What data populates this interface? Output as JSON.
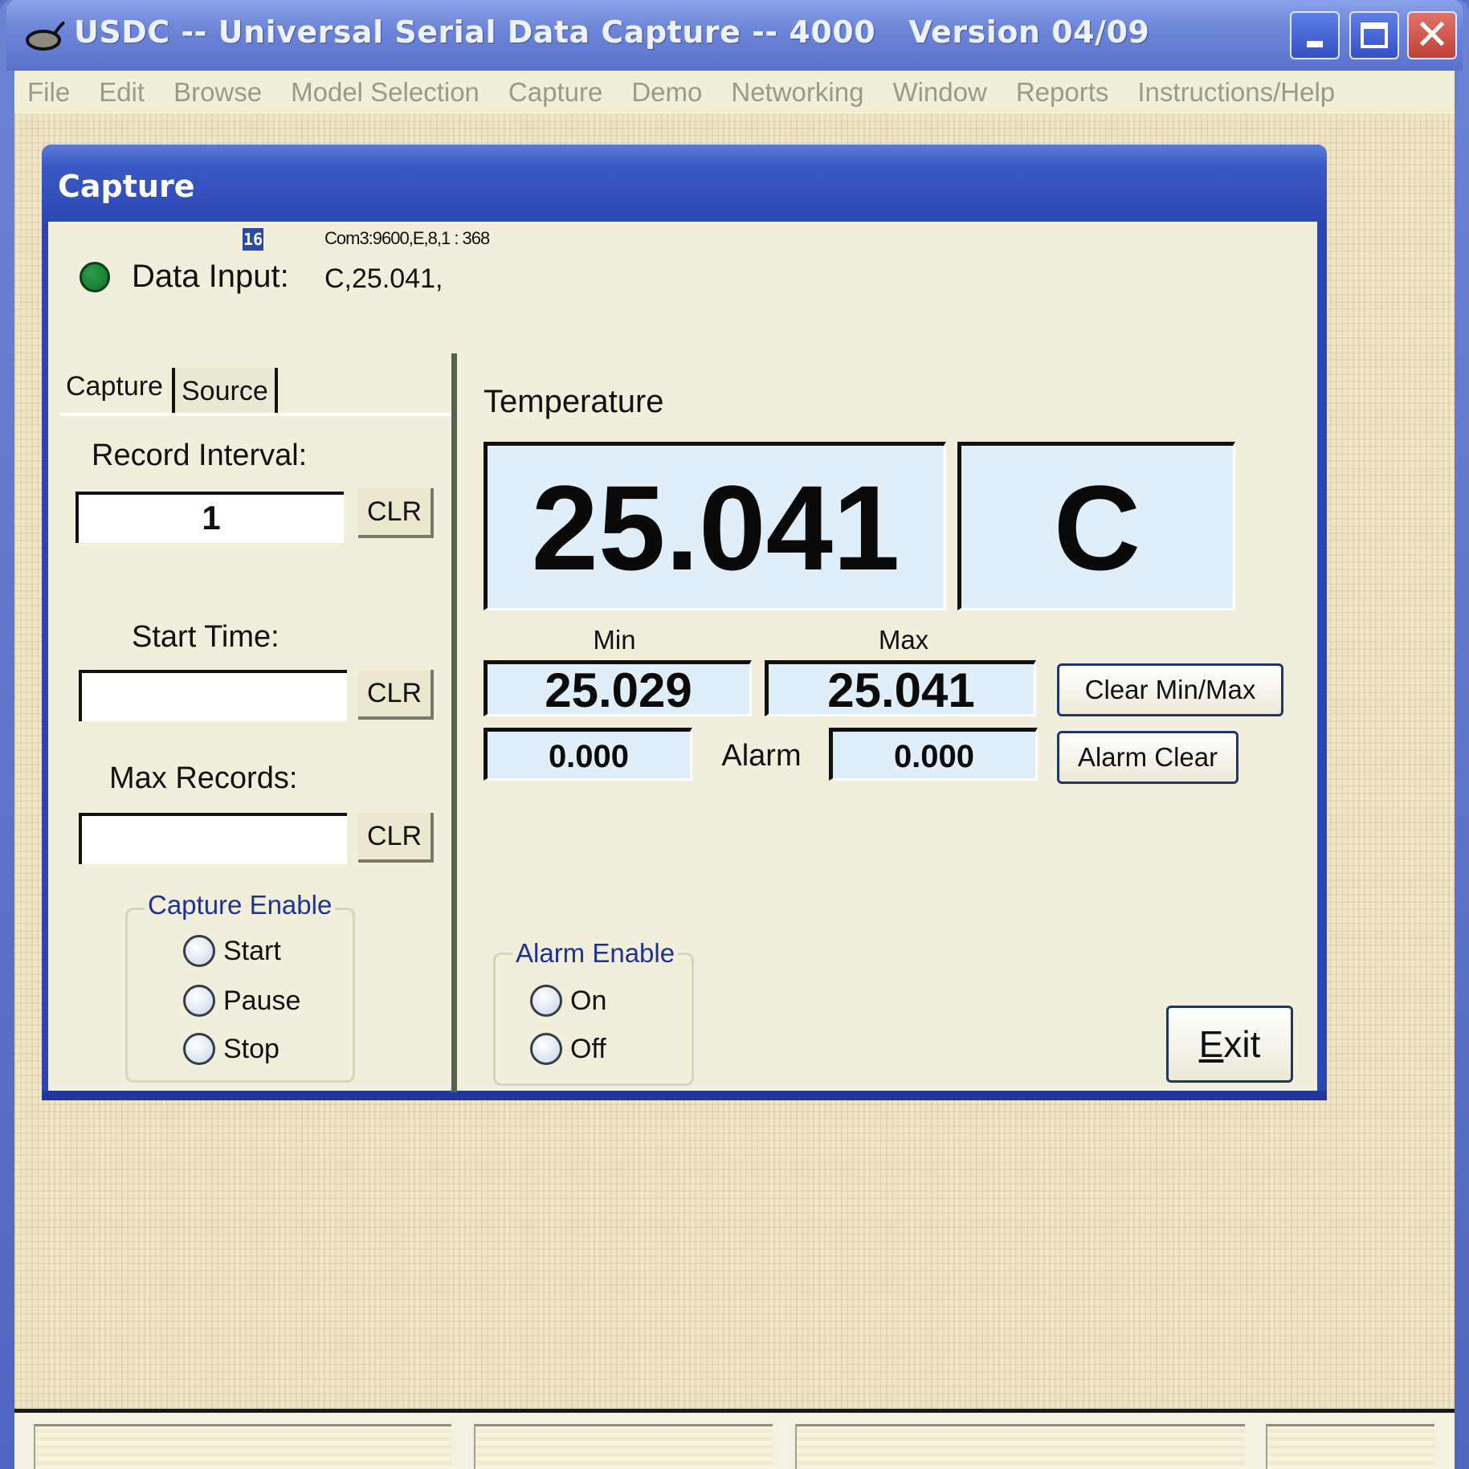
{
  "window": {
    "title": "USDC -- Universal Serial Data Capture -- 4000   Version 04/09",
    "icon": "usdc-app-icon",
    "controls": {
      "minimize_icon": "minimize-icon",
      "maximize_icon": "maximize-icon",
      "close_icon": "close-icon",
      "close_glyph": "✕"
    }
  },
  "menu": {
    "items": [
      {
        "label": "File"
      },
      {
        "label": "Edit"
      },
      {
        "label": "Browse"
      },
      {
        "label": "Model Selection"
      },
      {
        "label": "Capture"
      },
      {
        "label": "Demo"
      },
      {
        "label": "Networking"
      },
      {
        "label": "Window"
      },
      {
        "label": "Reports"
      },
      {
        "label": "Instructions/Help"
      }
    ]
  },
  "capture_window": {
    "title": "Capture",
    "header": {
      "icon_text": "16",
      "port_info": "Com3:9600,E,8,1 : 368",
      "data_input_label": "Data Input:",
      "data_input_value": "C,25.041,",
      "led_status": "active",
      "led_color": "#1f8a3c"
    },
    "tabs": [
      {
        "label": "Capture",
        "active": true
      },
      {
        "label": "Source",
        "active": false
      }
    ],
    "left_panel": {
      "record_interval": {
        "label": "Record Interval:",
        "value": "1",
        "clear_label": "CLR"
      },
      "start_time": {
        "label": "Start Time:",
        "value": "",
        "clear_label": "CLR"
      },
      "max_records": {
        "label": "Max Records:",
        "value": "",
        "clear_label": "CLR"
      },
      "capture_enable": {
        "title": "Capture Enable",
        "options": [
          {
            "label": "Start",
            "selected": false
          },
          {
            "label": "Pause",
            "selected": false
          },
          {
            "label": "Stop",
            "selected": false
          }
        ]
      }
    },
    "right_panel": {
      "measurement_label": "Temperature",
      "value": "25.041",
      "unit": "C",
      "min_label": "Min",
      "min_value": "25.029",
      "max_label": "Max",
      "max_value": "25.041",
      "clear_minmax_label": "Clear Min/Max",
      "alarm_low": "0.000",
      "alarm_label": "Alarm",
      "alarm_high": "0.000",
      "alarm_clear_label": "Alarm Clear",
      "alarm_enable": {
        "title": "Alarm Enable",
        "options": [
          {
            "label": "On",
            "selected": false
          },
          {
            "label": "Off",
            "selected": false
          }
        ]
      },
      "exit_label": "Exit",
      "exit_accesskey": "E"
    }
  },
  "statusbar": {
    "panels": [
      "",
      "",
      "",
      ""
    ]
  },
  "colors": {
    "title_bar": "#6d86d8",
    "child_title_bar": "#2c48b4",
    "dialog_bg": "#f1efdc",
    "display_bg": "#dfeef8",
    "group_title": "#1e3296",
    "menu_text_disabled": "#9a9a8c"
  }
}
